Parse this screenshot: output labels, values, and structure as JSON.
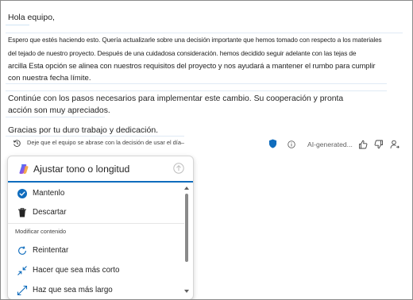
{
  "document": {
    "greeting": "Hola equipo,",
    "paragraph1": [
      "Espero que estés haciendo esto. Quería actualizarle sobre una decisión importante que hemos tomado con respecto a los materiales",
      "del tejado de nuestro proyecto. Después de una cuidadosa consideración. hemos decidido seguir adelante con las tejas de",
      "arcilla Esta opción se alinea con nuestros requisitos del proyecto y nos ayudará a mantener el rumbo para cumplir",
      "con nuestra fecha límite."
    ],
    "paragraph2": [
      "Continúe con los pasos necesarios para implementar este cambio. Su cooperación y pronta",
      "acción son muy apreciados."
    ],
    "closing": "Gracias por tu duro trabajo y dedicación."
  },
  "suggestion": {
    "text": "Deje que el equipo se abrase con la decisión de usar el día–",
    "icon": "history-icon"
  },
  "feedback_bar": {
    "ai_label": "AI-generated...",
    "icons": [
      "shield-icon",
      "info-icon",
      "thumbs-up-icon",
      "thumbs-down-icon",
      "share-icon"
    ],
    "shield_color": "#0f6cbd"
  },
  "copilot_popup": {
    "title": "Ajustar tono o longitud",
    "accent_color": "#0f6cbd",
    "items": [
      {
        "label": "Mantenlo",
        "icon": "check-circle-icon"
      },
      {
        "label": "Descartar",
        "icon": "trash-icon"
      }
    ],
    "section_label": "Modificar contenido",
    "modify_items": [
      {
        "label": "Reintentar",
        "icon": "retry-icon"
      },
      {
        "label": "Hacer que sea más corto",
        "icon": "shorten-icon"
      },
      {
        "label": "Haz que sea más largo",
        "icon": "lengthen-icon"
      }
    ]
  }
}
